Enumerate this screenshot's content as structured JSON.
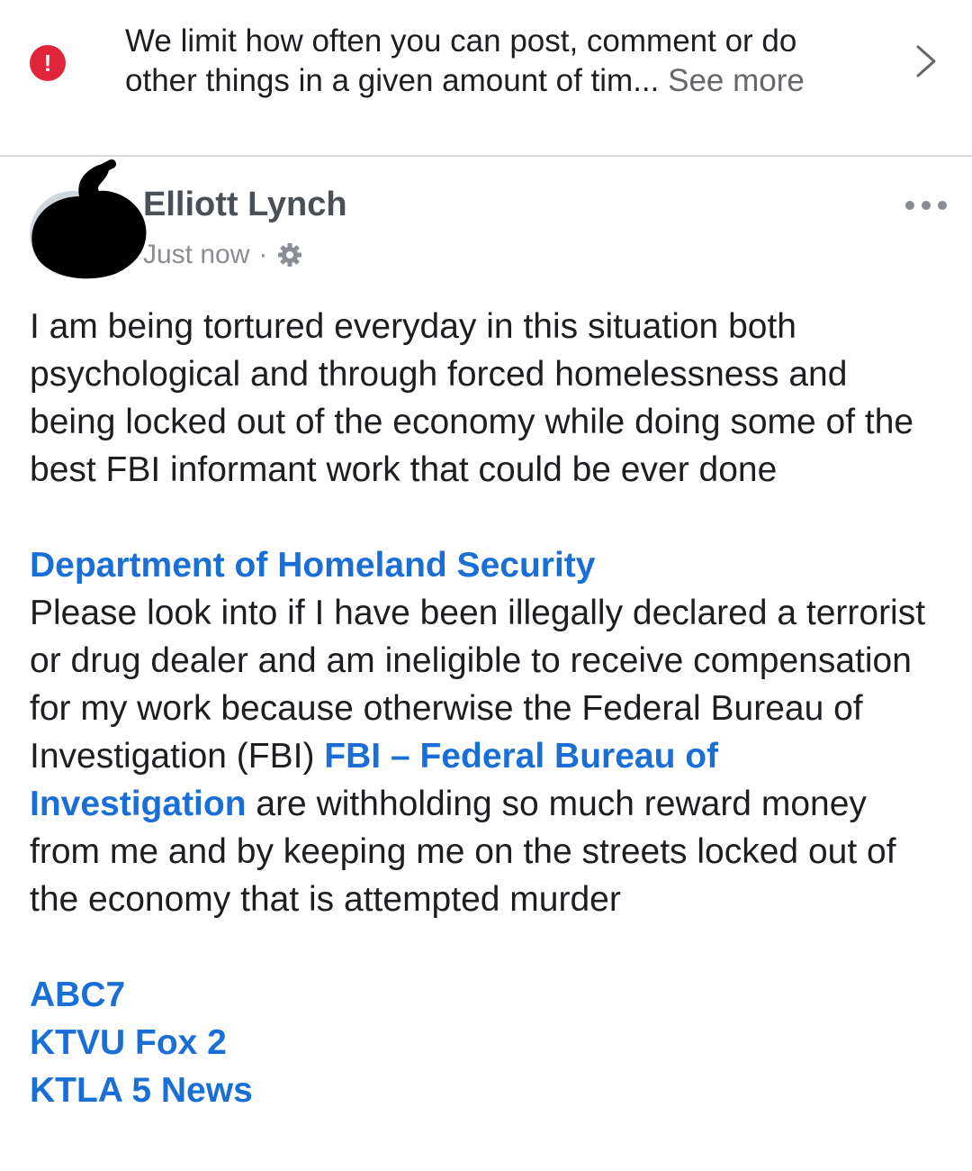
{
  "notice": {
    "icon": "alert-icon",
    "icon_glyph": "!",
    "icon_color": "#e0243a",
    "line1": "We limit how often you can post, comment or do",
    "line2": "other things in a given amount of tim... ",
    "see_more": "See more",
    "chevron_icon": "chevron-right-icon"
  },
  "post": {
    "author": "Elliott Lynch",
    "timestamp": "Just now",
    "separator": "·",
    "privacy_icon": "gear-icon",
    "menu_icon": "more-dots-icon",
    "paragraph1": "I am being tortured everyday in this situation both psychological and through forced homelessness and being locked out of the economy while doing some of the best FBI informant work that could be ever done",
    "mention_dhs": "Department of Homeland Security",
    "paragraph2_before": "Please look into if I have been illegally declared a terrorist or drug dealer and am ineligible to receive compensation for my work because otherwise the Federal Bureau of Investigation (FBI) ",
    "mention_fbi": "FBI – Federal Bureau of Investigation",
    "paragraph2_after": " are withholding so much reward money from me and by keeping me on the streets locked out of the economy that is attempted murder",
    "tags": [
      "ABC7",
      "KTVU Fox 2",
      "KTLA 5 News"
    ]
  },
  "colors": {
    "link": "#1a6fd6",
    "text": "#1c1e21",
    "secondary": "#65676b"
  }
}
